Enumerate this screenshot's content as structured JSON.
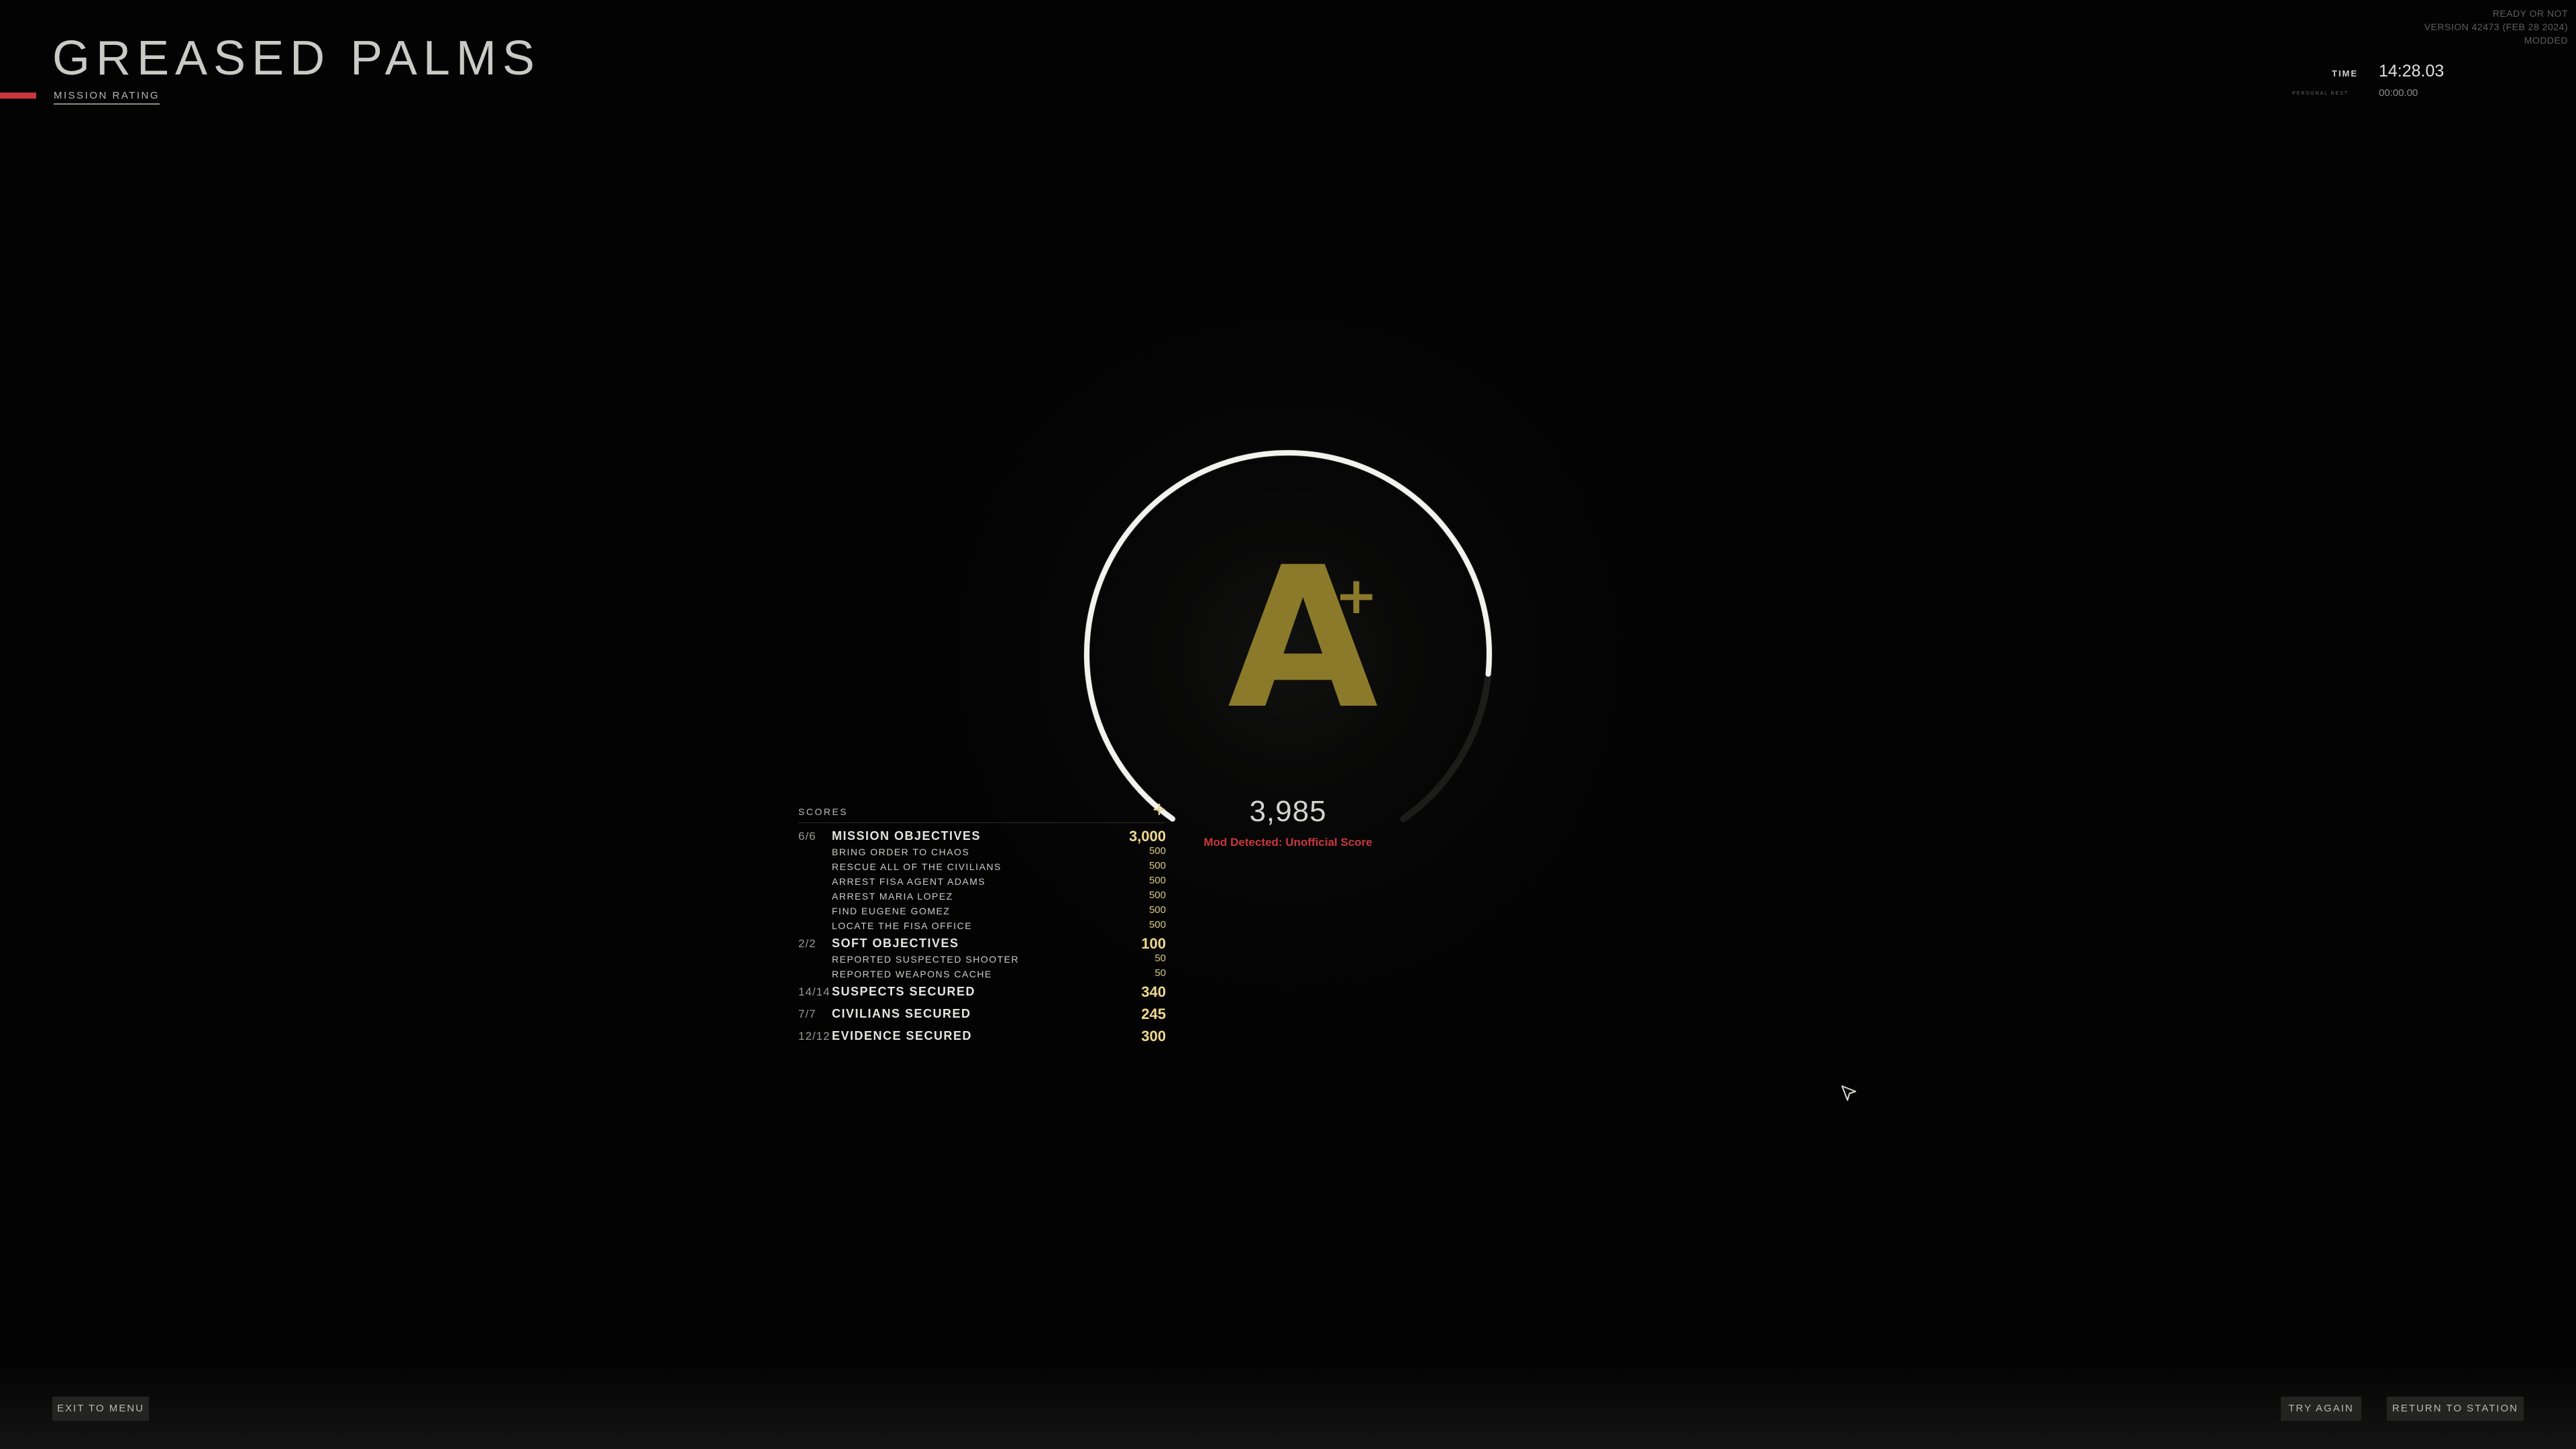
{
  "header": {
    "title": "GREASED PALMS",
    "subtitle": "MISSION RATING",
    "accent_color": "#c9363c"
  },
  "build_info": {
    "game": "READY OR NOT",
    "version": "VERSION 42473 (FEB 28 2024)",
    "status": "MODDED"
  },
  "timer": {
    "time_label": "TIME",
    "time_value": "14:28.03",
    "personal_best_label": "PERSONAL BEST",
    "personal_best_value": "00:00.00"
  },
  "rating": {
    "grade": "A",
    "grade_modifier": "+",
    "total_score": "3,985",
    "warning": "Mod Detected: Unofficial Score",
    "grade_color": "#8c7a2b",
    "warning_color": "#c9363c",
    "ring_fraction": 0.83
  },
  "scores": {
    "title": "SCORES",
    "expand_icon": "plus-icon",
    "categories": [
      {
        "count": "6/6",
        "label": "MISSION OBJECTIVES",
        "total": "3,000",
        "items": [
          {
            "label": "BRING ORDER TO CHAOS",
            "value": "500"
          },
          {
            "label": "RESCUE ALL OF THE CIVILIANS",
            "value": "500"
          },
          {
            "label": "ARREST FISA AGENT ADAMS",
            "value": "500"
          },
          {
            "label": "ARREST MARIA LOPEZ",
            "value": "500"
          },
          {
            "label": "FIND EUGENE GOMEZ",
            "value": "500"
          },
          {
            "label": "LOCATE THE FISA OFFICE",
            "value": "500"
          }
        ]
      },
      {
        "count": "2/2",
        "label": "SOFT OBJECTIVES",
        "total": "100",
        "items": [
          {
            "label": "REPORTED SUSPECTED SHOOTER",
            "value": "50"
          },
          {
            "label": "REPORTED WEAPONS CACHE",
            "value": "50"
          }
        ]
      },
      {
        "count": "14/14",
        "label": "SUSPECTS SECURED",
        "total": "340",
        "items": []
      },
      {
        "count": "7/7",
        "label": "CIVILIANS SECURED",
        "total": "245",
        "items": []
      },
      {
        "count": "12/12",
        "label": "EVIDENCE SECURED",
        "total": "300",
        "items": []
      }
    ]
  },
  "buttons": {
    "exit": "EXIT TO MENU",
    "retry": "TRY AGAIN",
    "return": "RETURN TO STATION"
  }
}
